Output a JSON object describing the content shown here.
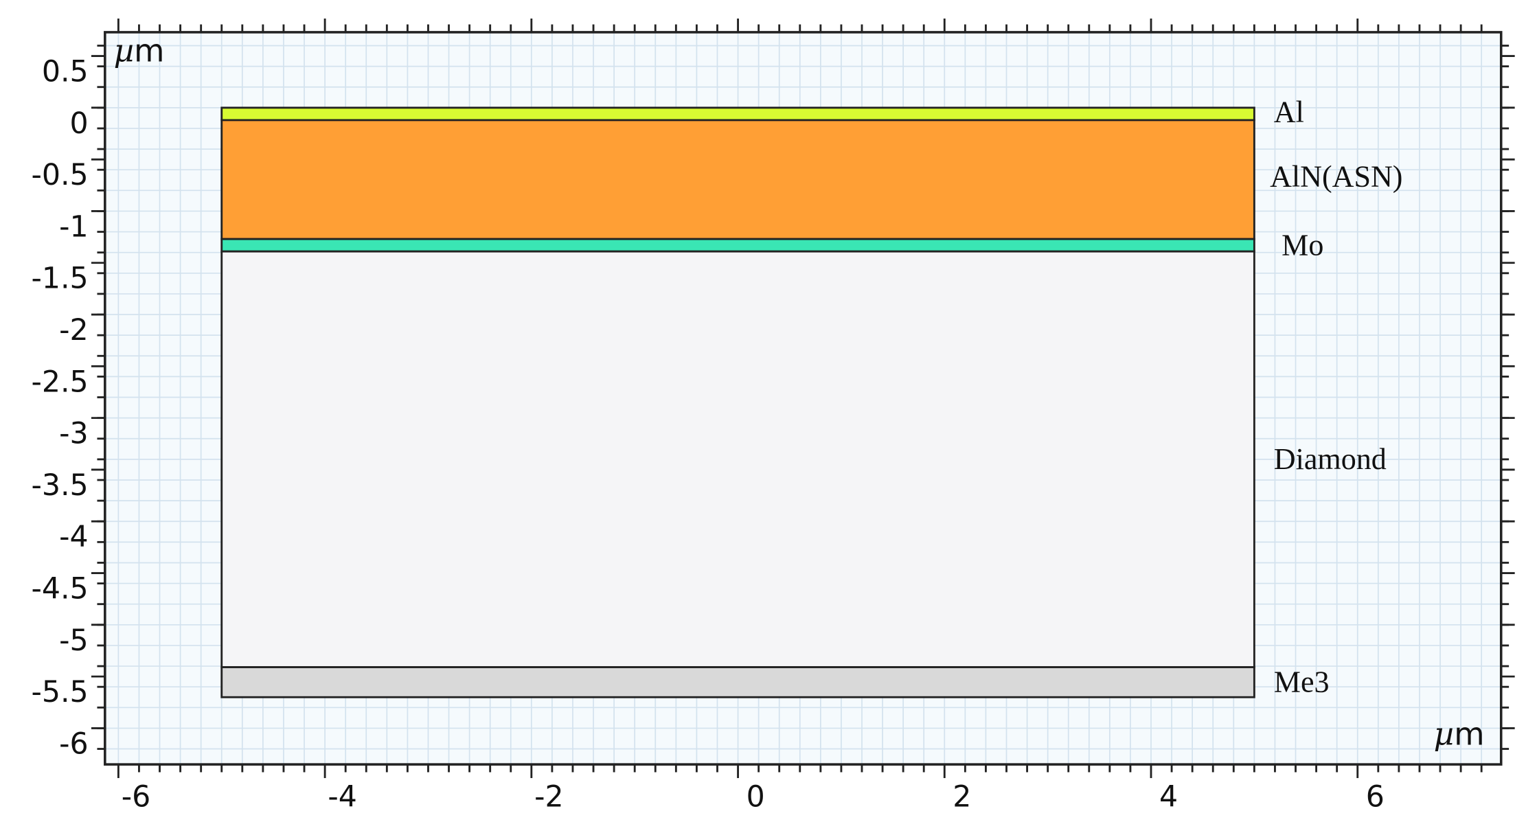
{
  "chart_data": {
    "type": "geometry-cross-section",
    "x_unit": "µm",
    "y_unit": "µm",
    "xlim": [
      -6.13,
      7.39
    ],
    "ylim": [
      -6.35,
      0.73
    ],
    "x_major_step": 2,
    "y_major_step": 0.5,
    "minor_step": 0.2,
    "grid": true,
    "x_ticks": [
      "-6",
      "-4",
      "-2",
      "0",
      "2",
      "4",
      "6"
    ],
    "y_ticks": [
      "0.5",
      "0",
      "-0.5",
      "-1",
      "-1.5",
      "-2",
      "-2.5",
      "-3",
      "-3.5",
      "-4",
      "-4.5",
      "-5",
      "-5.5",
      "-6"
    ],
    "layers": [
      {
        "name": "Al",
        "x": [
          -5.0,
          5.0
        ],
        "y": [
          -0.12,
          0.0
        ],
        "color": "#d8fa32"
      },
      {
        "name": "AlN(ASN)",
        "x": [
          -5.0,
          5.0
        ],
        "y": [
          -1.27,
          -0.12
        ],
        "color": "#ff9f35"
      },
      {
        "name": "Mo",
        "x": [
          -5.0,
          5.0
        ],
        "y": [
          -1.39,
          -1.27
        ],
        "color": "#3ae6b4"
      },
      {
        "name": "Diamond",
        "x": [
          -5.0,
          5.0
        ],
        "y": [
          -5.41,
          -1.39
        ],
        "color": "#f5f5f7"
      },
      {
        "name": "Me3",
        "x": [
          -5.0,
          5.0
        ],
        "y": [
          -5.7,
          -5.41
        ],
        "color": "#d9d9d9"
      }
    ],
    "colors": {
      "background": "#f5fafd",
      "grid": "#d3e2ee",
      "frame": "#222222"
    }
  },
  "units": {
    "mu": "µ",
    "m": "m"
  }
}
